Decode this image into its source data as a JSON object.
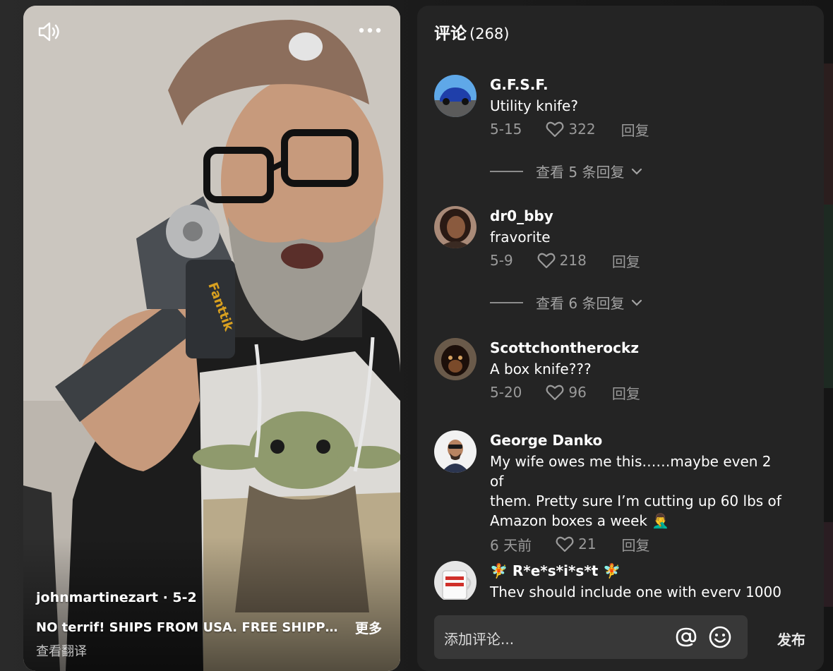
{
  "video": {
    "author_line": "johnmartinezart · 5-2",
    "description": "NO terrif! SHIPS FROM USA. FREE SHIPPIN…",
    "more_label": "更多",
    "translate_label": "查看翻译",
    "product_brand": "Fanttik",
    "icons": {
      "volume": "speaker-icon",
      "more": "ellipsis-icon"
    }
  },
  "comments_panel": {
    "title": "评论",
    "count": "(268)",
    "comments": [
      {
        "name": "G.F.S.F.",
        "text": "Utility knife?",
        "date": "5-15",
        "likes": "322",
        "reply": "回复",
        "view_replies": "查看 5 条回复"
      },
      {
        "name": "dr0_bby",
        "text": "fravorite",
        "date": "5-9",
        "likes": "218",
        "reply": "回复",
        "view_replies": "查看 6 条回复"
      },
      {
        "name": "Scottchontherockz",
        "text": "A box knife???",
        "date": "5-20",
        "likes": "96",
        "reply": "回复"
      },
      {
        "name": "George Danko",
        "text_lines": [
          "My wife owes me this……maybe even 2 of",
          "them. Pretty sure I’m cutting up 60 lbs of",
          "Amazon boxes a week 🤦‍♂️"
        ],
        "date": "6 天前",
        "likes": "21",
        "reply": "回复"
      },
      {
        "name": "🧚 R*e*s*i*s*t 🧚",
        "text": "Thev should include one with everv 1000"
      }
    ],
    "input_placeholder": "添加评论...",
    "post_label": "发布",
    "icons": {
      "mention": "at-icon",
      "emoji": "smiley-icon",
      "like": "heart-icon",
      "expand": "chevron-down-icon"
    }
  },
  "colors": {
    "panel_bg": "#242424",
    "input_bg": "#383838",
    "muted_text": "#9a9a9a"
  }
}
